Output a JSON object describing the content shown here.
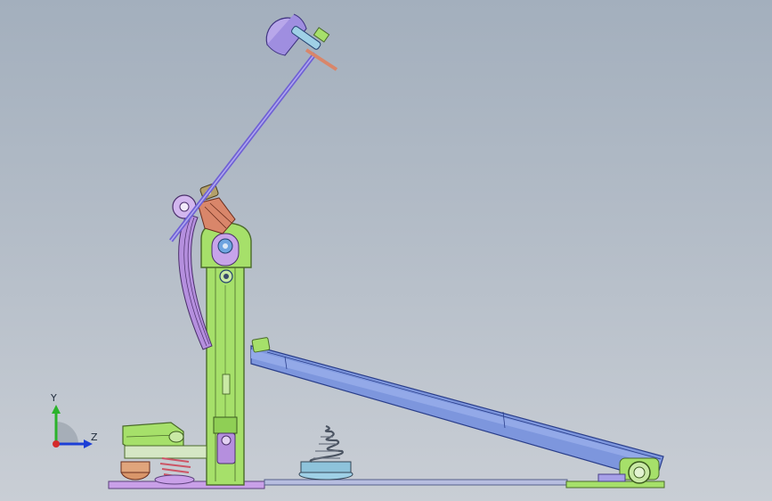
{
  "viewport": {
    "triad": {
      "y_label": "Y",
      "z_label": "Z",
      "colors": {
        "y": "#2bb22b",
        "z": "#1d3fd6",
        "origin": "#d42a2a"
      }
    },
    "colors": {
      "frame_green": "#a6e06a",
      "frame_outline": "#4a6a2a",
      "pedal_blue": "#7d96dd",
      "pedal_outline": "#2a3e8a",
      "beater_purple": "#8d7fe0",
      "link_pink": "#dd9de6",
      "cam_orange": "#d9866a",
      "base_purple": "#b58fde",
      "spring_gray": "#5c6470"
    }
  }
}
